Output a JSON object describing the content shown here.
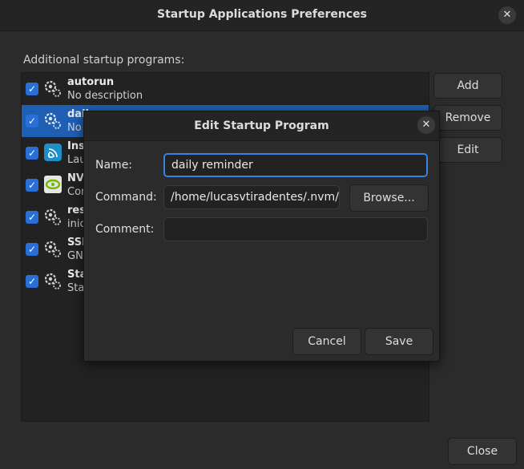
{
  "window": {
    "title": "Startup Applications Preferences",
    "close_icon": "✕",
    "section_label": "Additional startup programs:",
    "buttons": {
      "add": "Add",
      "remove": "Remove",
      "edit": "Edit",
      "close": "Close"
    },
    "programs": [
      {
        "name": "autorun",
        "description": "No description",
        "icon": "gear-icon",
        "checked": true,
        "selected": false
      },
      {
        "name": "dail",
        "description": "No",
        "icon": "gear-icon",
        "checked": true,
        "selected": true
      },
      {
        "name": "Ins",
        "description": "Lau",
        "icon": "signal-app-icon",
        "checked": true,
        "selected": false
      },
      {
        "name": "NV",
        "description": "Cor",
        "icon": "nvidia-icon",
        "checked": true,
        "selected": false
      },
      {
        "name": "res",
        "description": "inic",
        "icon": "gear-icon",
        "checked": true,
        "selected": false
      },
      {
        "name": "SSI",
        "description": "GN",
        "icon": "gear-icon",
        "checked": true,
        "selected": false
      },
      {
        "name": "Sta",
        "description": "Sta",
        "icon": "gear-icon",
        "checked": true,
        "selected": false
      }
    ]
  },
  "dialog": {
    "title": "Edit Startup Program",
    "close_icon": "✕",
    "name_label": "Name:",
    "name_value": "daily reminder",
    "command_label": "Command:",
    "command_value": "/home/lucasvtiradentes/.nvm/",
    "browse_label": "Browse...",
    "comment_label": "Comment:",
    "comment_value": "",
    "cancel_label": "Cancel",
    "save_label": "Save"
  },
  "colors": {
    "accent": "#3584e4",
    "selection": "#1e5fb4",
    "checkbox": "#2a6fd6"
  }
}
